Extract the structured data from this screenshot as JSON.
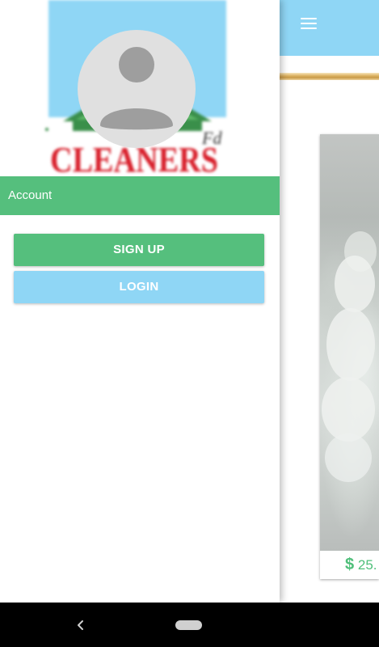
{
  "app": {
    "product": {
      "currency_symbol": "$",
      "price_partial": "25."
    },
    "colors": {
      "toolbar": "#8fd6f5",
      "accent_gold": "#d4a857",
      "price_text": "#4fbf7a"
    }
  },
  "drawer": {
    "logo_text": "CLEANERS",
    "account_label": "Account",
    "signup_label": "SIGN UP",
    "login_label": "LOGIN",
    "colors": {
      "primary_green": "#55bf7d",
      "light_blue": "#8fd6f5",
      "avatar_bg": "#e0e0e0",
      "avatar_fg": "#9e9e9e"
    }
  },
  "system_nav": {
    "icons": [
      "back-icon",
      "home-pill-icon"
    ]
  }
}
